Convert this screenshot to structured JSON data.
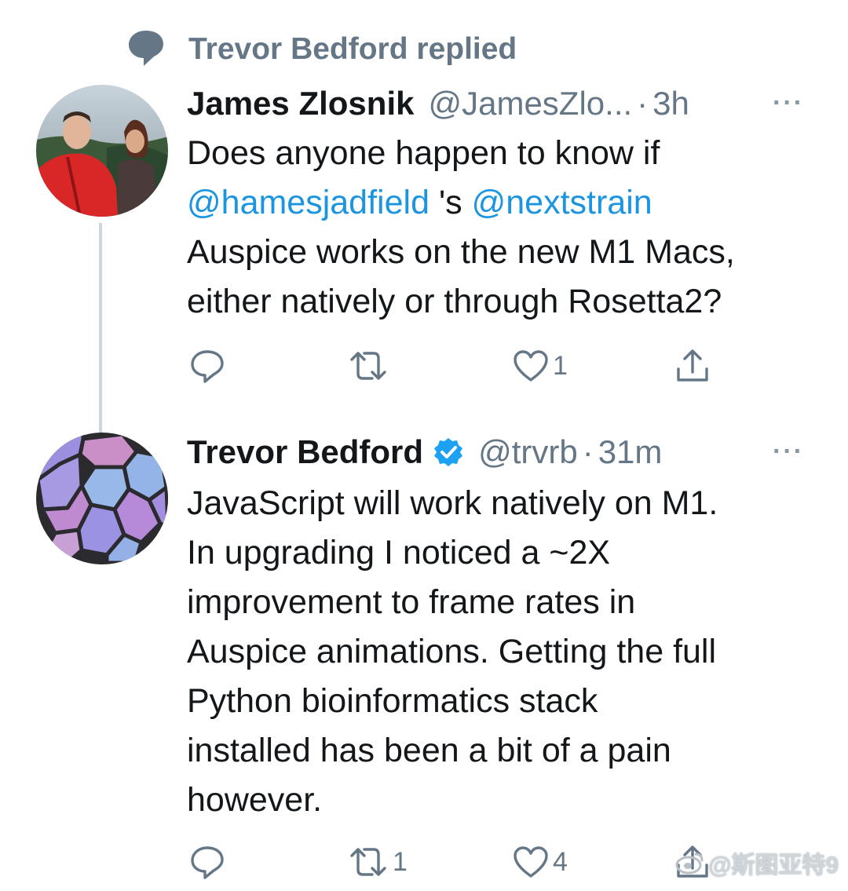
{
  "context": {
    "icon": "speech-bubble-icon",
    "text": "Trevor Bedford replied"
  },
  "tweets": [
    {
      "author_name": "James Zlosnik",
      "handle": "@JamesZlo...",
      "separator": "·",
      "time": "3h",
      "more": "···",
      "body_lines": [
        "Does anyone happen to know if",
        "'s",
        "Auspice works on the new M1 Macs,",
        "either natively or through Rosetta2?"
      ],
      "mentions": [
        "@hamesjadfield",
        "@nextstrain"
      ],
      "actions": {
        "reply_count": "",
        "retweet_count": "",
        "like_count": "1",
        "share_count": ""
      }
    },
    {
      "author_name": "Trevor Bedford",
      "verified": true,
      "handle": "@trvrb",
      "separator": "·",
      "time": "31m",
      "more": "···",
      "body_lines": [
        "JavaScript will work natively on M1.",
        "In upgrading I noticed a ~2X",
        "improvement to frame rates in",
        "Auspice animations. Getting the full",
        "Python bioinformatics stack",
        "installed has been a bit of a pain",
        "however."
      ],
      "actions": {
        "reply_count": "",
        "retweet_count": "1",
        "like_count": "4",
        "share_count": ""
      }
    }
  ],
  "watermark": "@斯图亚特9",
  "colors": {
    "link": "#1b95e0",
    "muted": "#657786",
    "verified": "#1da1f2",
    "thread_line": "#ccd6dd"
  }
}
